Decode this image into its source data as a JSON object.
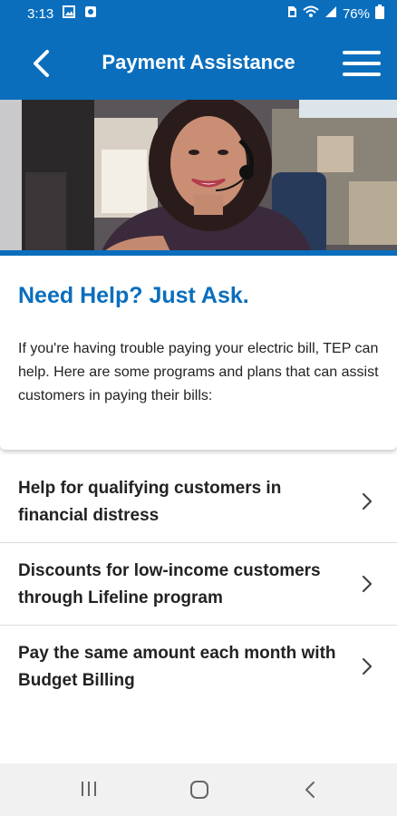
{
  "status_bar": {
    "time": "3:13",
    "battery": "76%",
    "icons": [
      "image-icon",
      "notification-icon",
      "sim-icon",
      "wifi-icon",
      "signal-icon",
      "battery-icon"
    ]
  },
  "app_bar": {
    "title": "Payment Assistance",
    "back_icon": "chevron-left-icon",
    "menu_icon": "hamburger-menu-icon",
    "color": "#0a6ebd"
  },
  "hero": {
    "image": "customer-service-agent-photo"
  },
  "intro": {
    "title": "Need Help? Just Ask.",
    "body": "If you're having trouble paying your electric bill, TEP can help. Here are some programs and plans that can assist customers in paying their bills:"
  },
  "programs": [
    {
      "label": "Help for qualifying customers in financial distress"
    },
    {
      "label": "Discounts for low-income customers through Lifeline program"
    },
    {
      "label": "Pay the same amount each month with Budget Billing"
    }
  ],
  "nav_bar": {
    "buttons": [
      "recent-apps-icon",
      "home-icon",
      "back-icon"
    ]
  }
}
